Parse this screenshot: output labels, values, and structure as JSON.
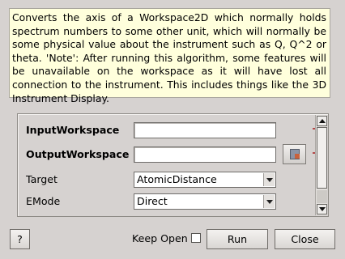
{
  "description": "Converts the axis of a Workspace2D which normally holds spectrum numbers to some other unit, which will normally be some physical value about the instrument such as Q, Q^2 or theta.  'Note': After running this algorithm, some features will be unavailable on the workspace as it will have lost all connection to the instrument. This includes things like the 3D Instrument Display.",
  "params": {
    "input_workspace": {
      "label": "InputWorkspace",
      "value": ""
    },
    "output_workspace": {
      "label": "OutputWorkspace",
      "value": ""
    },
    "target": {
      "label": "Target",
      "value": "AtomicDistance"
    },
    "emode": {
      "label": "EMode",
      "value": "Direct"
    }
  },
  "footer": {
    "help_label": "?",
    "keep_open_label": "Keep Open",
    "keep_open_checked": false,
    "run_label": "Run",
    "close_label": "Close"
  },
  "icons": {
    "browse": "workspace-browse-icon"
  }
}
